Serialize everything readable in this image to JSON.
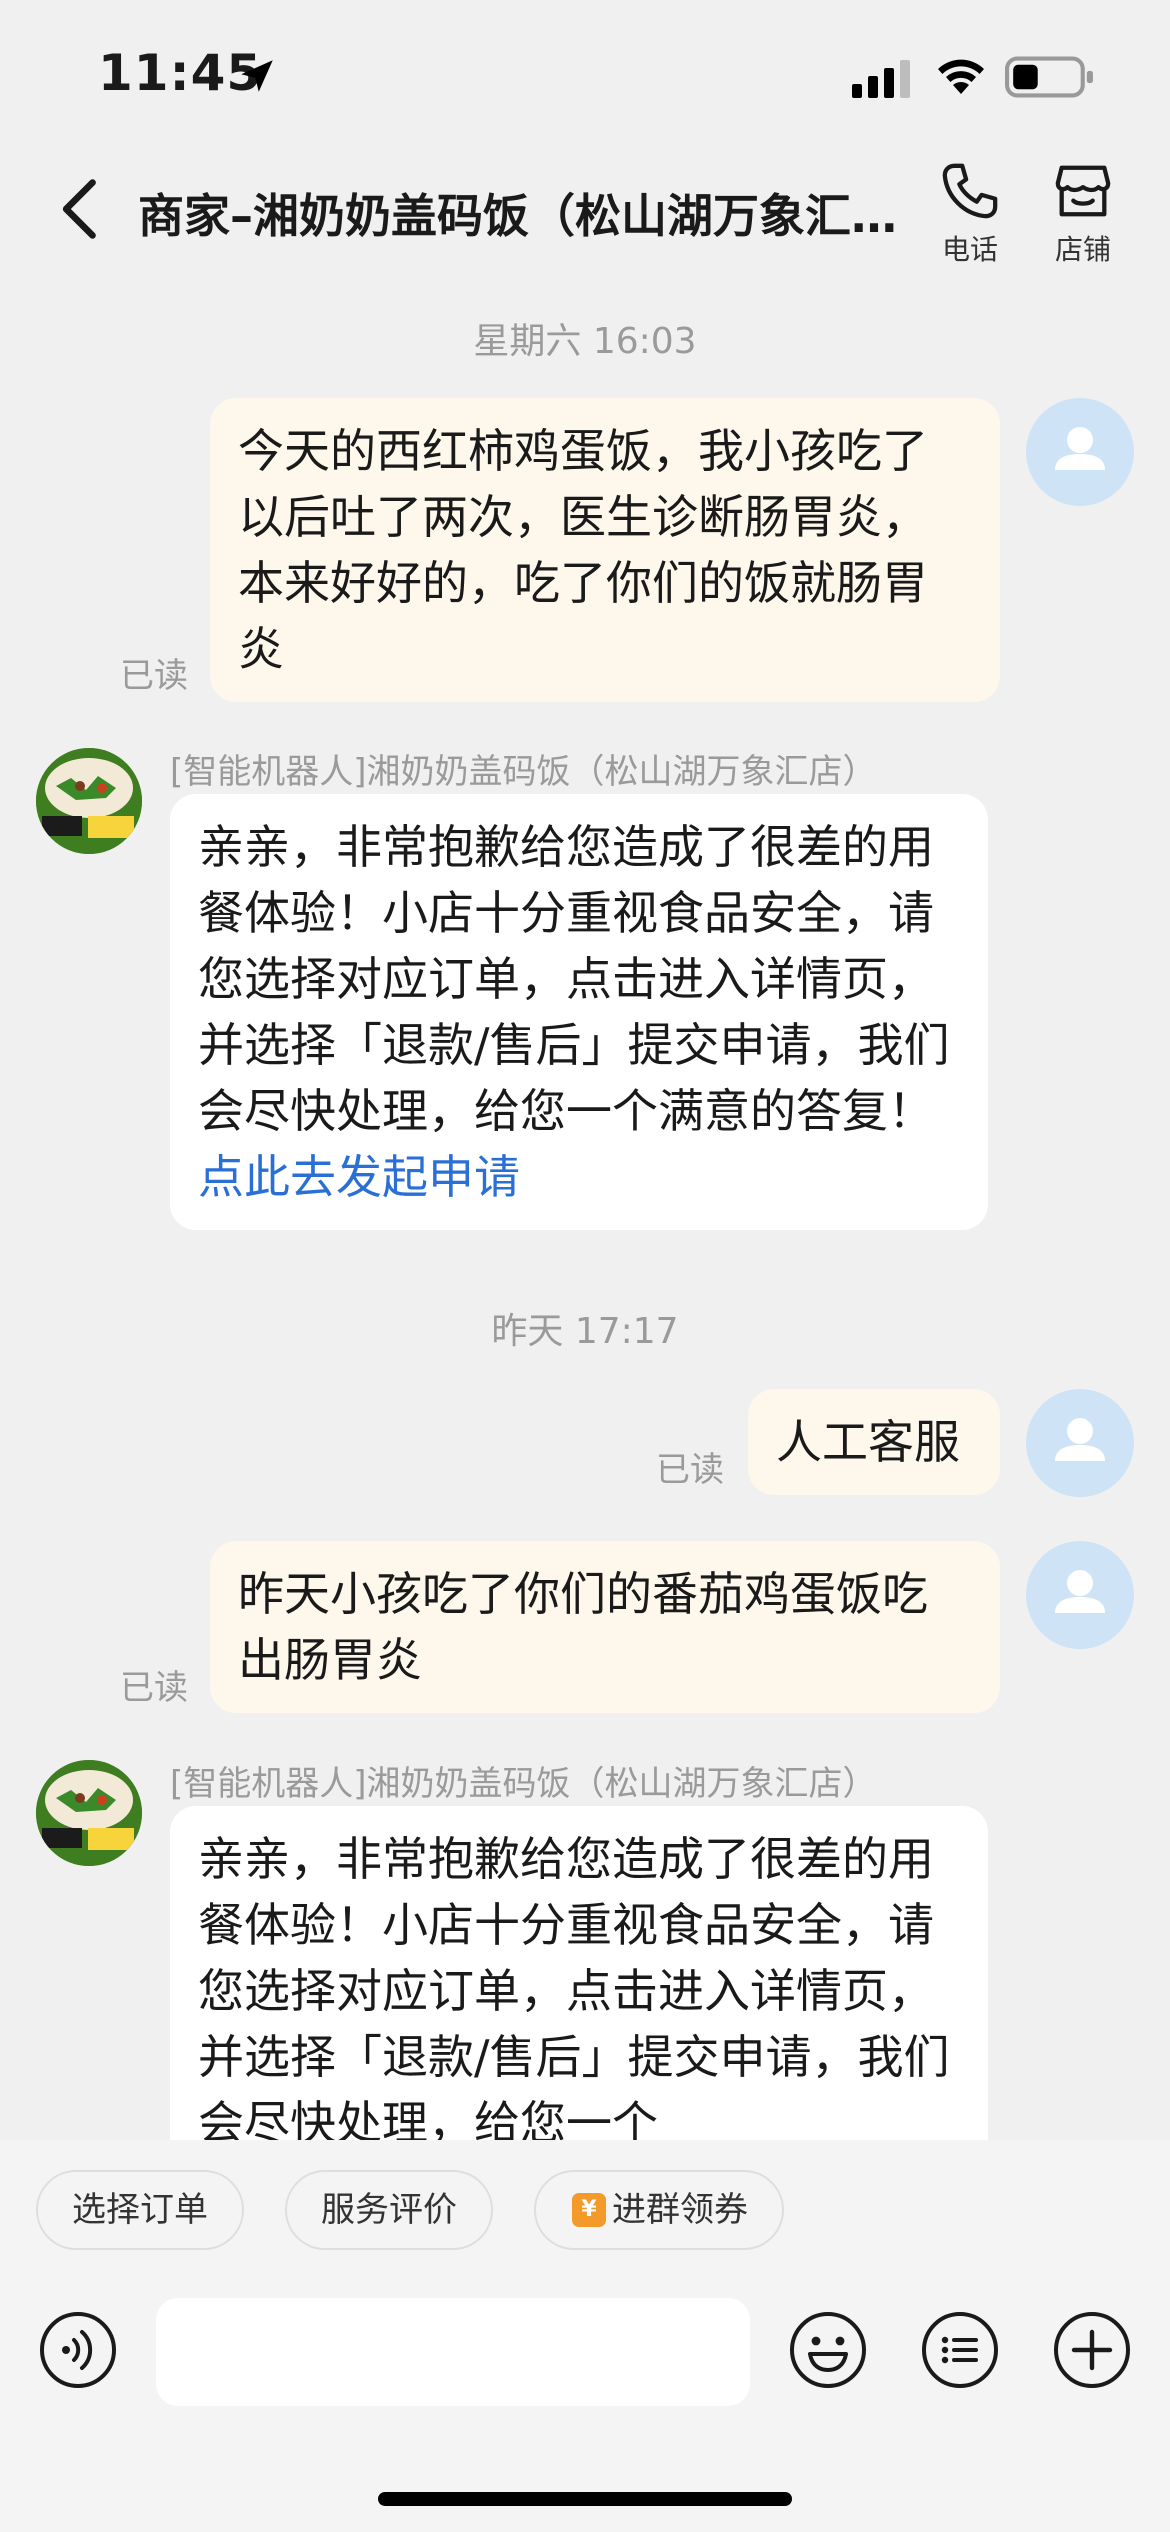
{
  "status_bar": {
    "time": "11:45"
  },
  "header": {
    "title": "商家–湘奶奶盖码饭（松山湖万象汇店）",
    "phone_label": "电话",
    "store_label": "店铺"
  },
  "messages": {
    "ts1": "星期六 16:03",
    "m1_text": "今天的西红柿鸡蛋饭，我小孩吃了以后吐了两次，医生诊断肠胃炎，本来好好的，吃了你们的饭就肠胃炎",
    "m1_read": "已读",
    "m2_sender": "[智能机器人]湘奶奶盖码饭（松山湖万象汇店）",
    "m2_text": "亲亲，非常抱歉给您造成了很差的用餐体验！小店十分重视食品安全，请您选择对应订单，点击进入详情页，并选择「退款/售后」提交申请，我们会尽快处理，给您一个满意的答复！",
    "m2_link": "点此去发起申请",
    "ts2": "昨天 17:17",
    "m3_text": "人工客服",
    "m3_read": "已读",
    "m4_text": "昨天小孩吃了你们的番茄鸡蛋饭吃出肠胃炎",
    "m4_read": "已读",
    "m5_sender": "[智能机器人]湘奶奶盖码饭（松山湖万象汇店）",
    "m5_text": "亲亲，非常抱歉给您造成了很差的用餐体验！小店十分重视食品安全，请您选择对应订单，点击进入详情页，并选择「退款/售后」提交申请，我们会尽快处理，给您一个"
  },
  "quick_actions": {
    "select_order": "选择订单",
    "service_review": "服务评价",
    "join_group_coupon": "进群领券",
    "coupon_icon": "¥"
  },
  "colors": {
    "outgoing_bubble": "#fdf7ec",
    "incoming_bubble": "#ffffff",
    "link": "#2a6fd6",
    "avatar_bg": "#cfe3f6"
  }
}
